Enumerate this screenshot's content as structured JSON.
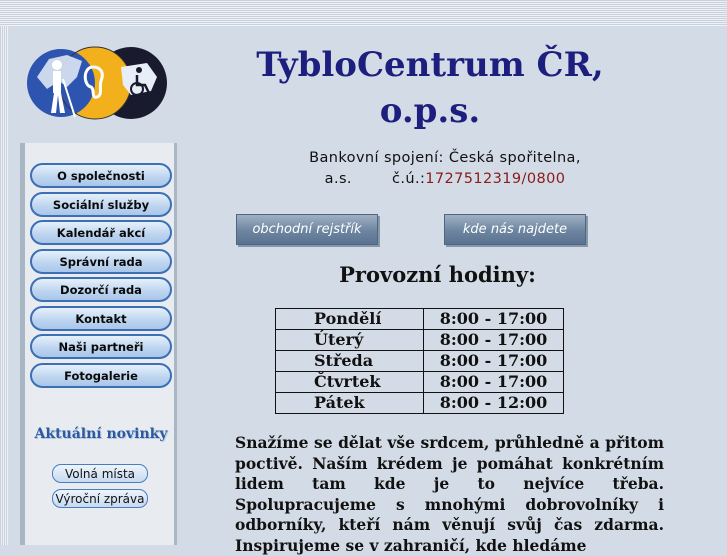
{
  "header": {
    "title_line1": "TybloCentrum ČR,",
    "title_line2": "o.p.s.",
    "bank_line1": "Bankovní spojení: Česká spořitelna,",
    "bank_line2_prefix": "a.s.        č.ú.:",
    "bank_account": "1727512319/0800"
  },
  "buttons": {
    "rejstrik": "obchodní rejstřík",
    "najdete": "kde nás najdete"
  },
  "sidebar": {
    "items": [
      {
        "label": "O společnosti"
      },
      {
        "label": "Sociální služby"
      },
      {
        "label": "Kalendář akcí"
      },
      {
        "label": "Správní rada"
      },
      {
        "label": "Dozorčí rada"
      },
      {
        "label": "Kontakt"
      },
      {
        "label": "Naši partneři"
      },
      {
        "label": "Fotogalerie"
      }
    ],
    "news_heading": "Aktuální novinky",
    "news_buttons": {
      "volna": "Volná místa",
      "vyrocni": "Výroční zpráva"
    }
  },
  "hours": {
    "heading": "Provozní hodiny:",
    "rows": [
      {
        "day": "Pondělí",
        "time": "8:00 - 17:00"
      },
      {
        "day": "Úterý",
        "time": "8:00 - 17:00"
      },
      {
        "day": "Středa",
        "time": "8:00 - 17:00"
      },
      {
        "day": "Čtvrtek",
        "time": "8:00 - 17:00"
      },
      {
        "day": "Pátek",
        "time": "8:00 - 12:00"
      }
    ]
  },
  "intro": {
    "text": "Snažíme se dělat vše srdcem, průhledně a přitom poctivě. Naším krédem je pomáhat konkrétním lidem tam kde je to nejvíce třeba. Spolupracujeme s mnohými dobrovolníky i odborníky, kteří nám věnují svůj čas zdarma. Inspirujeme se v zahraničí, kde hledáme"
  },
  "colors": {
    "title": "#1d1f7e",
    "account": "#8b1a1a",
    "menu_border": "#3c6fb4",
    "news_heading": "#2c5aa0"
  },
  "icons": {
    "logo": "tyflocentrum-logo-icon"
  }
}
